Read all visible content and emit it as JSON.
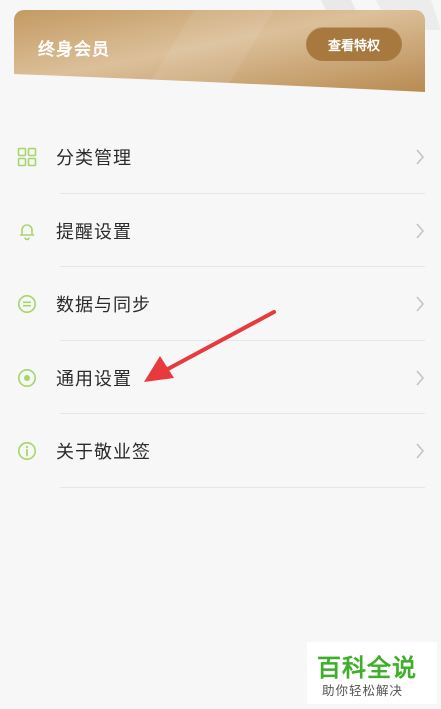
{
  "vip_card": {
    "title": "终身会员",
    "button_label": "查看特权"
  },
  "menu": {
    "items": [
      {
        "label": "分类管理",
        "icon": "grid-icon"
      },
      {
        "label": "提醒设置",
        "icon": "bell-icon"
      },
      {
        "label": "数据与同步",
        "icon": "sync-icon"
      },
      {
        "label": "通用设置",
        "icon": "settings-dot-icon"
      },
      {
        "label": "关于敬业签",
        "icon": "info-icon"
      }
    ]
  },
  "watermark": {
    "brand": "百科全说",
    "slogan": "助你轻松解决"
  },
  "colors": {
    "accent_green": "#a6d66a",
    "gold_dark": "#a8793f",
    "gold_light": "#d8b98b",
    "annotation_red": "#e8393c",
    "watermark_green": "#3fae2a"
  }
}
